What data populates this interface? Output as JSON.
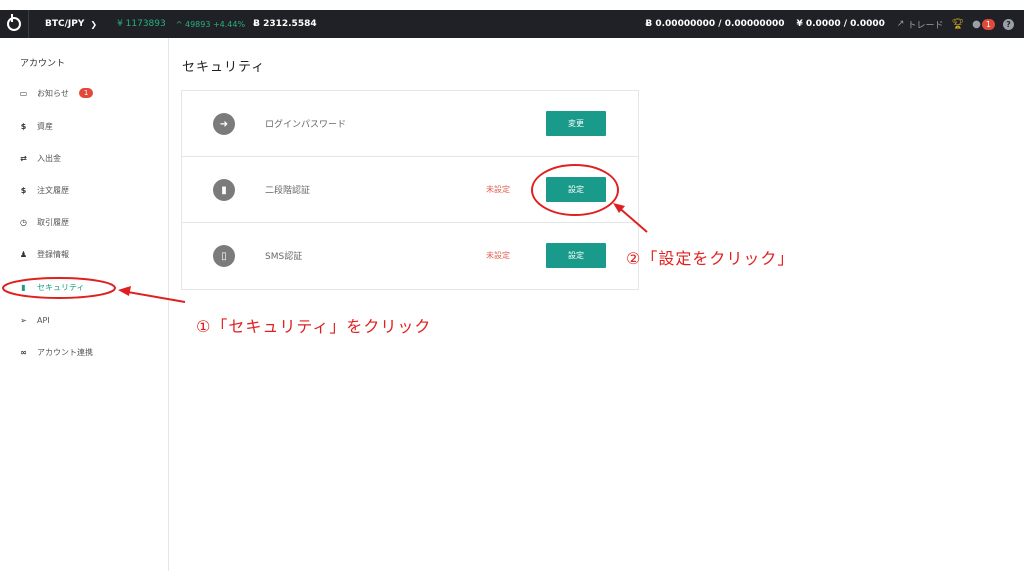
{
  "topbar": {
    "pair": "BTC/JPY",
    "price": "¥ 1173893",
    "change": "^ 49893 +4.44%",
    "volume": "Ƀ 2312.5584",
    "btc_balance": "Ƀ 0.00000000 / 0.00000000",
    "jpy_balance": "¥ 0.0000 / 0.0000",
    "trade_label": "トレード",
    "notification_count": "1",
    "help": "?"
  },
  "sidebar": {
    "title": "アカウント",
    "items": [
      {
        "label": "お知らせ",
        "icon": "inbox-icon",
        "badge": "1"
      },
      {
        "label": "資産",
        "icon": "dollar-icon"
      },
      {
        "label": "入出金",
        "icon": "transfer-icon"
      },
      {
        "label": "注文履歴",
        "icon": "dollar-icon"
      },
      {
        "label": "取引履歴",
        "icon": "clock-icon"
      },
      {
        "label": "登録情報",
        "icon": "user-icon"
      },
      {
        "label": "セキュリティ",
        "icon": "lock-icon",
        "active": true
      },
      {
        "label": "API",
        "icon": "paper-plane-icon"
      },
      {
        "label": "アカウント連携",
        "icon": "link-icon"
      }
    ]
  },
  "main": {
    "title": "セキュリティ",
    "rows": [
      {
        "label": "ログインパスワード",
        "status": "",
        "button": "変更",
        "icon": "sign-in-icon"
      },
      {
        "label": "二段階認証",
        "status": "未設定",
        "button": "設定",
        "icon": "lock-icon"
      },
      {
        "label": "SMS認証",
        "status": "未設定",
        "button": "設定",
        "icon": "mobile-icon"
      }
    ]
  },
  "annotations": {
    "step1": "①「セキュリティ」をクリック",
    "step2": "②「設定をクリック」"
  },
  "colors": {
    "accent": "#1a9a8a",
    "topbar": "#1f2126",
    "annotation": "#e02020",
    "status_unset": "#e0614f"
  }
}
